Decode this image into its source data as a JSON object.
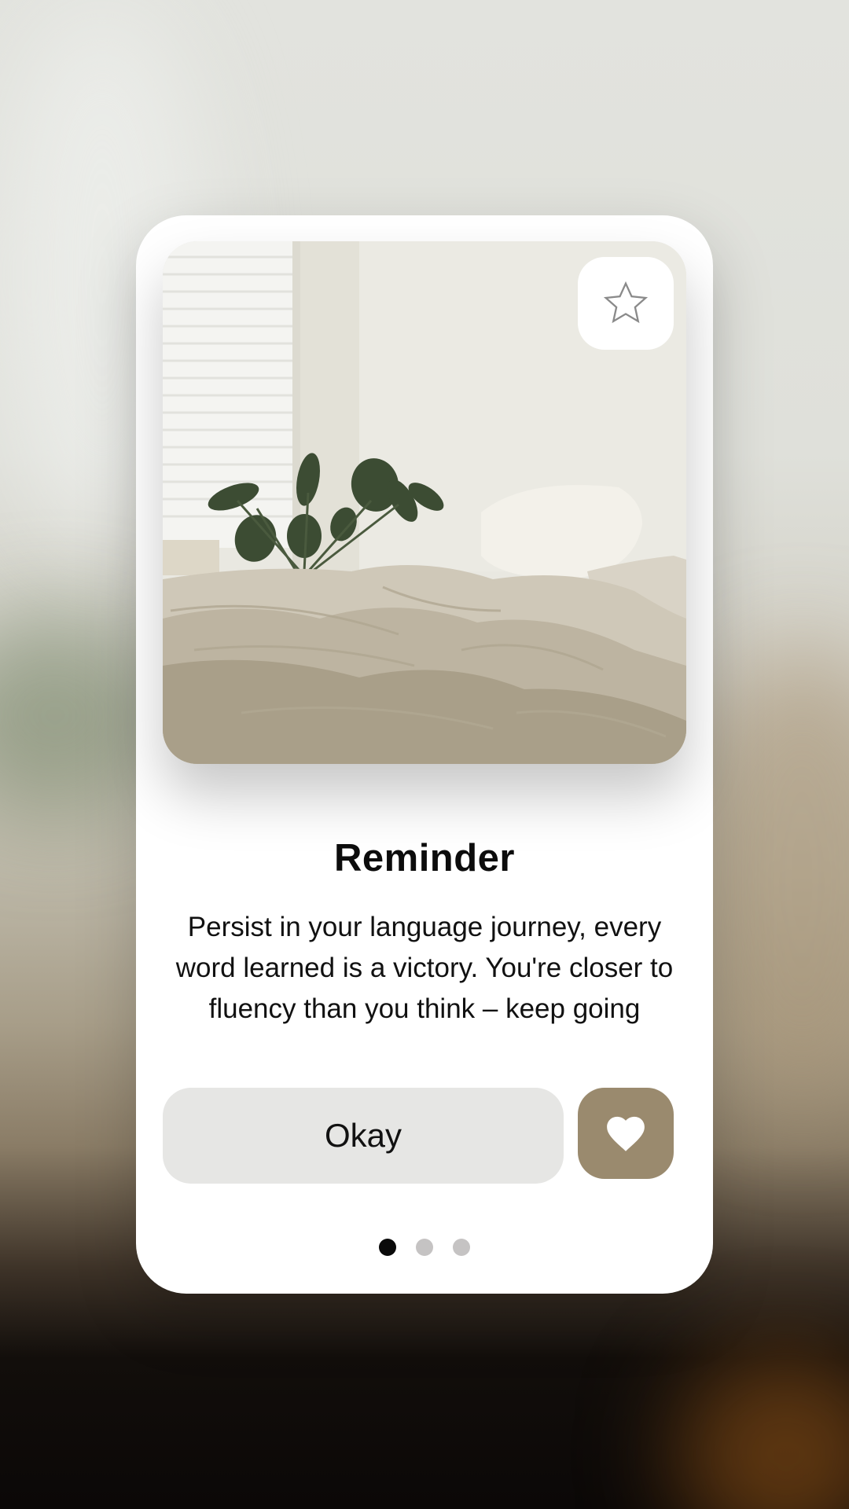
{
  "card": {
    "title": "Reminder",
    "message": "Persist in your language journey, every word learned is a victory. You're closer to fluency than you think – keep going"
  },
  "image": {
    "subject": "bedroom-with-plant-and-unmade-bed"
  },
  "icons": {
    "favorite": "star-outline-icon",
    "like": "heart-icon"
  },
  "actions": {
    "okay_label": "Okay"
  },
  "pager": {
    "total": 3,
    "current": 1
  },
  "colors": {
    "accent": "#9a8a6e",
    "okay_bg": "#e6e6e4",
    "dot_active": "#0a0a0a",
    "dot_inactive": "#c5c3c3"
  }
}
